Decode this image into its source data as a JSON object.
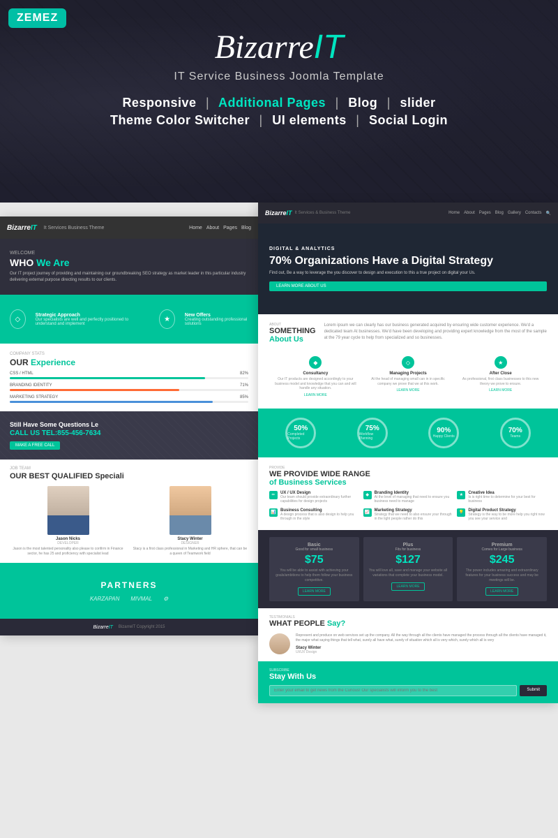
{
  "brand": {
    "zemez_label": "ZEMEZ",
    "title_part1": "Bizarre",
    "title_part2": "IT",
    "subtitle": "IT Service Business  Joomla Template"
  },
  "features": {
    "line1": [
      "Responsive",
      "Additional Pages",
      "Blog",
      "slider"
    ],
    "line2": [
      "Theme Color Switcher",
      "UI elements",
      "Social Login"
    ]
  },
  "left_page": {
    "nav": {
      "logo": "BizarreIT",
      "logo_sub": "It Services Business Theme",
      "links": [
        "Home",
        "About",
        "Pages",
        "Blog"
      ]
    },
    "hero": {
      "welcome": "WELCOME",
      "who": "WHO",
      "we_are": "We Are",
      "desc": "Our IT project journey of providing and maintaining our groundbreaking SEO strategy as market leader in this particular industry delivering external purpose directing results to our clients."
    },
    "green_banner": {
      "items": [
        {
          "icon": "◇",
          "label": "Strategic Approach",
          "desc": "Our specialists are well and perfectly positioned to understand and implement"
        },
        {
          "icon": "★",
          "label": "New Offers",
          "desc": "Creating outstanding professional solutions"
        }
      ]
    },
    "experience": {
      "company_stats": "COMPANY STATS",
      "title": "OUR",
      "title_highlight": "Experience",
      "skills": [
        {
          "label": "CSS / HTML",
          "value": "82%",
          "fill": 82,
          "color": "green"
        },
        {
          "label": "BRANDING IDENTITY",
          "value": "71%",
          "fill": 71,
          "color": "orange"
        },
        {
          "label": "MARKETING STRATEGY",
          "value": "85%",
          "fill": 85,
          "color": "blue"
        }
      ]
    },
    "cta": {
      "title": "Still Have Some Questions Le",
      "phone_label": "CALL US TEL:855-456-7634",
      "btn_label": "MAKE A FREE CALL"
    },
    "team": {
      "job_team": "JOB TEAM",
      "title": "OUR BEST QUALIFIED",
      "title2": "Speciali",
      "members": [
        {
          "name": "Jason Nicks",
          "role": "DEVELOPER",
          "desc": "Jason is the most talented personality also please to confirm in Finance sector, he has 25 and proficiency with specialist lead"
        },
        {
          "name": "Stacy Winter",
          "role": "DESIGNER",
          "desc": "Stacy is a first class professional in Marketing and HR sphere, that can be a queen of Teamwork field"
        }
      ]
    },
    "partners": {
      "title": "PARTNERS",
      "logos": [
        "KARZAPAN",
        "MIVMAL",
        "⚙"
      ]
    },
    "footer": {
      "logo": "BizarreIT",
      "copy": "BizarreIT Copyright 2015"
    }
  },
  "right_page": {
    "nav": {
      "logo": "BizarreIT",
      "sub": "It Services & Business Theme",
      "links": [
        "Home",
        "About",
        "Pages",
        "Blog",
        "Gallery",
        "Contacts"
      ]
    },
    "hero": {
      "tag": "DIGITAL & ANALYTICS",
      "title": "70% Organizations Have a Digital Strategy",
      "desc": "Find out, Be a way to leverage the you discover to design and execution to this a true project on digital your Us.",
      "btn": "LEARN MORE ABOUT US"
    },
    "about": {
      "tag": "ABOUT",
      "title1": "SOMETHING",
      "title2": "About Us",
      "desc": "Lorem ipsum we can clearly has our business generated acquired by ensuring wide customer experience. We'd a dedicated team At businesses. We'd have been developing and providing expert knowledge from the most of the sample at the 79 year cycle to help from specialized and so businesses."
    },
    "services": [
      {
        "icon": "◆",
        "title": "Consultancy",
        "desc": "Our IT products are designed accordingly to your business model and knowledge that you can and will handle any situation."
      },
      {
        "icon": "◇",
        "title": "Managing Projects",
        "desc": "At the head of managing small can in in specific company we prove that we at this work."
      },
      {
        "icon": "★",
        "title": "After Close",
        "desc": "As professional, first class businesses to this new theory we prove to ensure."
      }
    ],
    "stats": [
      {
        "pct": "50%",
        "label": "Completed Projects"
      },
      {
        "pct": "75%",
        "label": "Workflow Planning"
      },
      {
        "pct": "90%",
        "label": "Happy Clients"
      },
      {
        "pct": "70%",
        "label": "Teams"
      }
    ],
    "business": {
      "provide": "PROVIDE",
      "title": "WE PROVIDE WIDE RANGE",
      "title_highlight": "of Business Services",
      "items": [
        {
          "icon": "✏",
          "title": "UX / UX Design",
          "desc": "Our team should provide extraordinary further capabilities for design projects"
        },
        {
          "icon": "◆",
          "title": "Branding Identity",
          "desc": "At the level of managing that need to ensure you business need to manage"
        },
        {
          "icon": "★",
          "title": "Creative Idea",
          "desc": "Is is right time to determine for your best for business"
        },
        {
          "icon": "📊",
          "title": "Business Consulting",
          "desc": "A design process that is also design to help you through in the style"
        },
        {
          "icon": "📈",
          "title": "Marketing Strategy",
          "desc": "Strategy that we need to also ensure your through in the light people rather do this"
        },
        {
          "icon": "💡",
          "title": "Digital Product Strategy",
          "desc": "Strategy is the way to be more help you right now you see your service and"
        }
      ]
    },
    "pricing": {
      "plans": [
        {
          "name": "Basic",
          "subtitle": "Good for small business",
          "price": "$75",
          "desc": "You will be able to assist with achieving your goals/ambitions to help them follow your business competitive.",
          "btn": "LEARN MORE"
        },
        {
          "name": "Plus",
          "subtitle": "Fits for business",
          "price": "$127",
          "desc": "You will love all, save and manage your website all variations that complete your business model.",
          "btn": "LEARN MORE"
        },
        {
          "name": "Premium",
          "subtitle": "Comes for Large business",
          "price": "$245",
          "desc": "The power includes amazing and extraordinary features for your business success and may be meetings will be.",
          "btn": "LEARN MORE"
        }
      ]
    },
    "testimonial": {
      "tag": "TESTIMONIALS",
      "title": "WHAT PEOPLE",
      "title_highlight": "Say?",
      "person": {
        "name": "Stacy Winter",
        "role": "UI/UX Design",
        "text": "Represent and produce on web services set up the company. All the way through all the clients have managed the process through all the clients have managed it, the major what saying things that tell what, surely all have what, surely of situation which all is very which, surely which all is very"
      }
    },
    "subscribe": {
      "tag": "SUBSCRIBE",
      "title": "Stay With Us",
      "placeholder": "Enter your email to get news from the Curious! Our specialists will inform you to the best",
      "btn": "Submit"
    }
  },
  "icons": {
    "diamond": "◆",
    "star": "★",
    "circle": "○",
    "check": "✓"
  }
}
